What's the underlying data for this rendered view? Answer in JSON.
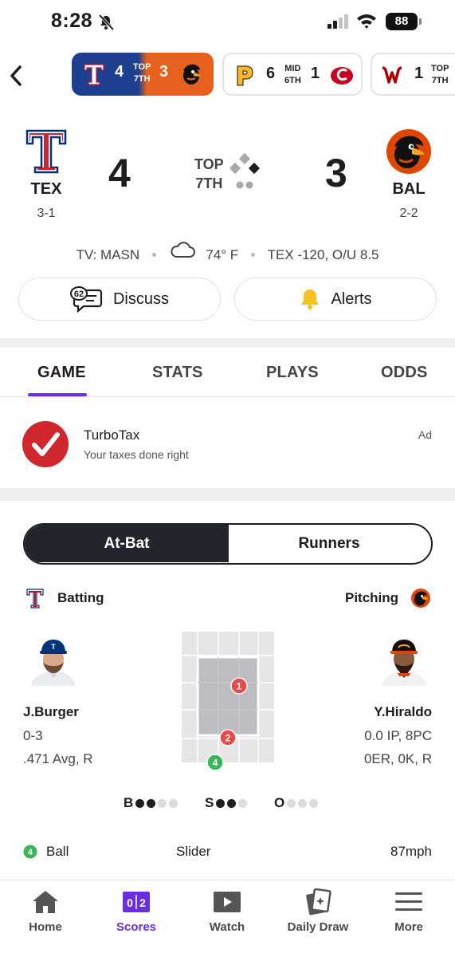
{
  "status_bar": {
    "time": "8:28",
    "battery": "88"
  },
  "score_strip": [
    {
      "away_score": "4",
      "inning_top": "TOP",
      "inning_bottom": "7TH",
      "home_score": "3"
    },
    {
      "away_score": "6",
      "inning_top": "MID",
      "inning_bottom": "6TH",
      "home_score": "1"
    },
    {
      "away_score": "1",
      "inning_top": "TOP",
      "inning_bottom": "7TH"
    }
  ],
  "game": {
    "away": {
      "abbr": "TEX",
      "record": "3-1",
      "score": "4"
    },
    "home": {
      "abbr": "BAL",
      "record": "2-2",
      "score": "3"
    },
    "inning_top": "TOP",
    "inning_bottom": "7TH"
  },
  "info": {
    "tv": "TV: MASN",
    "weather": "74° F",
    "odds": "TEX -120, O/U 8.5"
  },
  "actions": {
    "discuss_label": "Discuss",
    "discuss_count": "62",
    "alerts_label": "Alerts"
  },
  "tabs": [
    "GAME",
    "STATS",
    "PLAYS",
    "ODDS"
  ],
  "ad": {
    "title": "TurboTax",
    "subtitle": "Your taxes done right",
    "tag": "Ad"
  },
  "toggle": {
    "at_bat": "At-Bat",
    "runners": "Runners"
  },
  "matchup": {
    "batting_label": "Batting",
    "pitching_label": "Pitching",
    "batter": {
      "name": "J.Burger",
      "line1": "0-3",
      "line2": ".471 Avg, R"
    },
    "pitcher": {
      "name": "Y.Hiraldo",
      "line1": "0.0 IP, 8PC",
      "line2": "0ER, 0K, R"
    }
  },
  "pitches": [
    {
      "num": "1",
      "result": "ball"
    },
    {
      "num": "2",
      "result": "ball"
    },
    {
      "num": "4",
      "result": "ball"
    }
  ],
  "count": {
    "balls_label": "B",
    "strikes_label": "S",
    "outs_label": "O",
    "balls": 2,
    "strikes": 2,
    "outs": 0
  },
  "last_pitch": {
    "num": "4",
    "result": "Ball",
    "type": "Slider",
    "speed": "87mph"
  },
  "colors": {
    "accent": "#6a2ee0",
    "ball_red": "#e84a4a",
    "strike_green": "#3bb55a"
  },
  "bottom_nav": [
    {
      "label": "Home",
      "icon": "home-icon"
    },
    {
      "label": "Scores",
      "icon": "scores-icon"
    },
    {
      "label": "Watch",
      "icon": "play-icon"
    },
    {
      "label": "Daily Draw",
      "icon": "cards-icon"
    },
    {
      "label": "More",
      "icon": "menu-icon"
    }
  ]
}
